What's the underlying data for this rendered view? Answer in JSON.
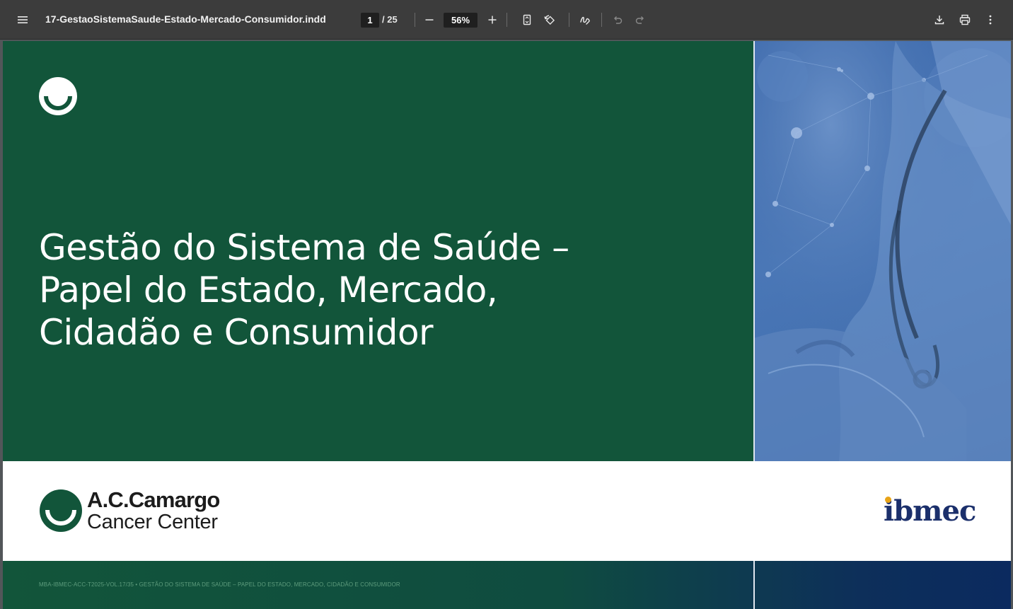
{
  "toolbar": {
    "document_title": "17-GestaoSistemaSaude-Estado-Mercado-Consumidor.indd",
    "current_page": "1",
    "total_pages": "/ 25",
    "zoom": "56%",
    "icons": [
      "menu-icon",
      "zoom-out-icon",
      "zoom-in-icon",
      "fit-page-icon",
      "rotate-icon",
      "annotate-icon",
      "undo-icon",
      "redo-icon",
      "download-icon",
      "print-icon",
      "more-vert-icon"
    ]
  },
  "page": {
    "title_lines": [
      "Gestão do Sistema de Saúde –",
      "Papel do Estado, Mercado,",
      "Cidadão e Consumidor"
    ],
    "brand_left": {
      "name": "A.C.Camargo",
      "subtitle": "Cancer Center"
    },
    "brand_right": {
      "name": "ibmec"
    },
    "footer": "MBA-IBMEC-ACC-T2025-VOL.17/35 • GESTÃO DO SISTEMA DE SAÚDE – PAPEL DO ESTADO, MERCADO, CIDADÃO E CONSUMIDOR",
    "colors": {
      "green": "#12553a",
      "photo_blue": "#4a78b8",
      "ibmec_navy": "#1b2f6b",
      "ibmec_dot": "#e8a317"
    }
  }
}
